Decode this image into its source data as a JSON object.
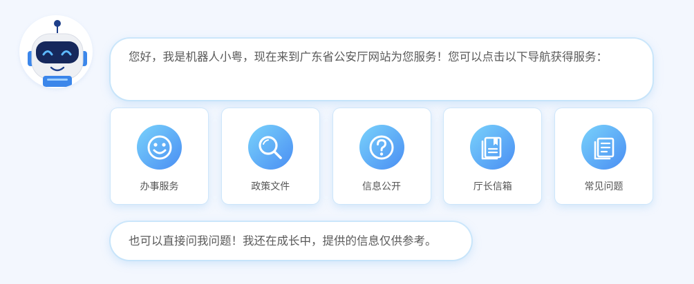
{
  "assistant": {
    "avatar_icon": "robot-icon",
    "greeting": "您好，我是机器人小粤，现在来到广东省公安厅网站为您服务！您可以点击以下导航获得服务：",
    "footer": "也可以直接问我问题！我还在成长中，提供的信息仅供参考。"
  },
  "nav": {
    "items": [
      {
        "label": "办事服务",
        "icon": "smiley-face-icon"
      },
      {
        "label": "政策文件",
        "icon": "magnifier-icon"
      },
      {
        "label": "信息公开",
        "icon": "question-mark-icon"
      },
      {
        "label": "厅长信箱",
        "icon": "mailbox-book-icon"
      },
      {
        "label": "常见问题",
        "icon": "document-list-icon"
      }
    ]
  },
  "colors": {
    "background": "#f3f7fe",
    "icon_gradient_start": "#79d2fb",
    "icon_gradient_end": "#4a8ef3",
    "bubble_glow": "#bee1fa",
    "text": "#5a5a5a"
  }
}
